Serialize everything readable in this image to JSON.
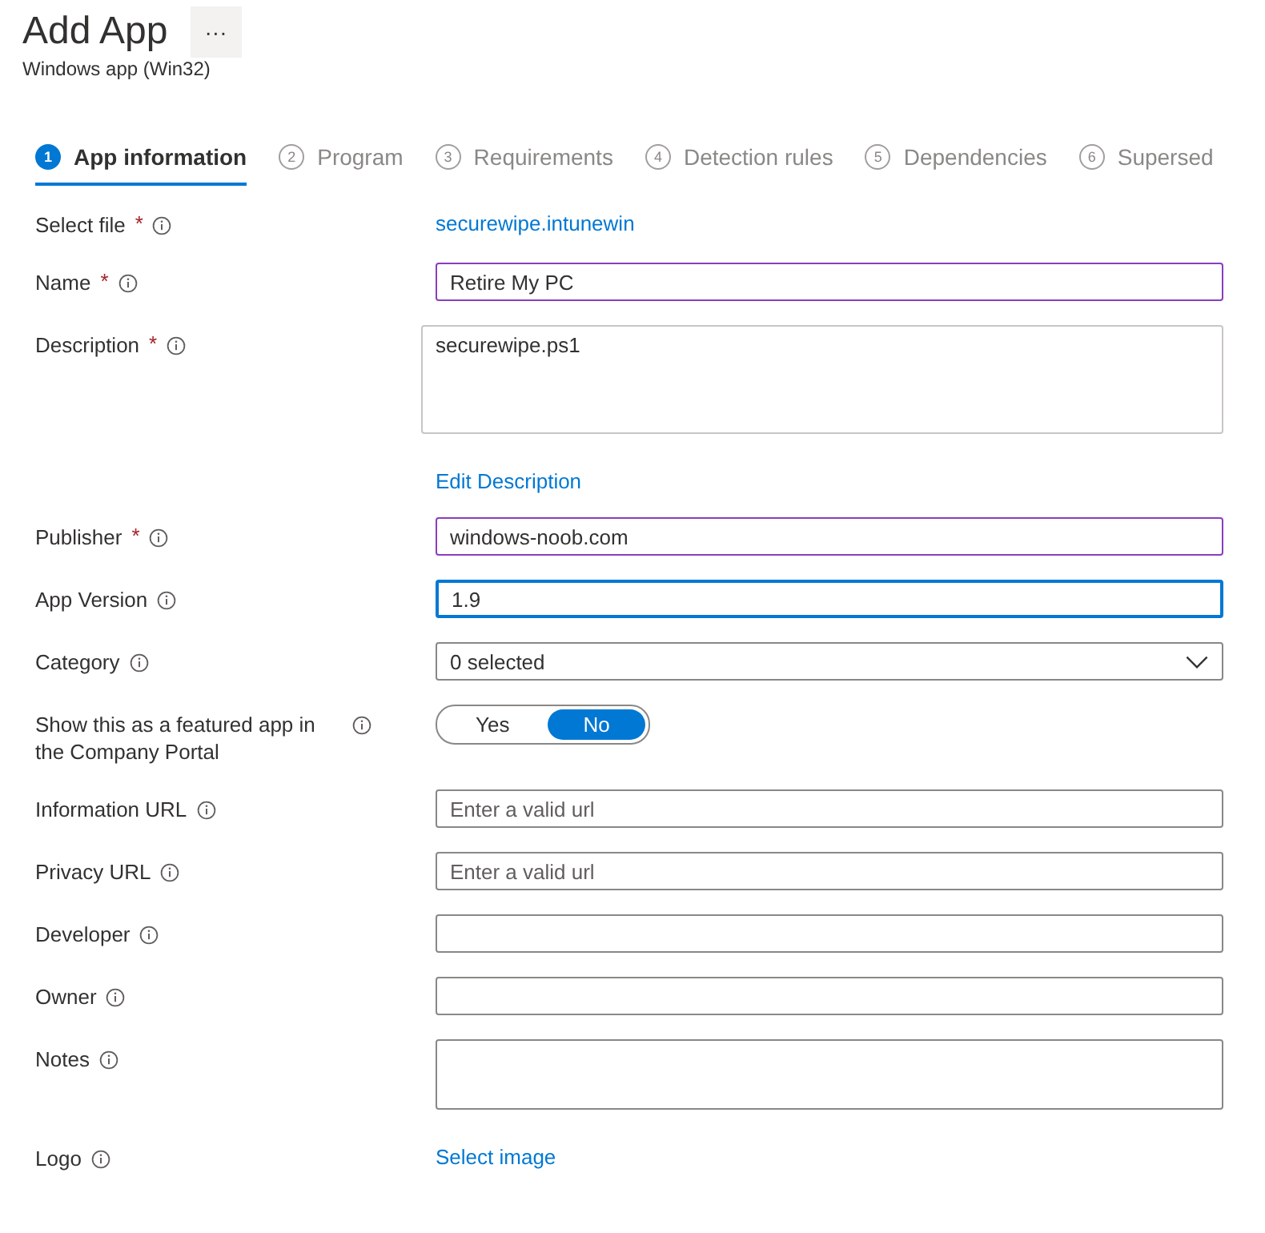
{
  "header": {
    "title": "Add App",
    "more": "···",
    "subtitle": "Windows app (Win32)"
  },
  "steps": [
    {
      "number": "1",
      "label": "App information",
      "selected": true
    },
    {
      "number": "2",
      "label": "Program",
      "selected": false
    },
    {
      "number": "3",
      "label": "Requirements",
      "selected": false
    },
    {
      "number": "4",
      "label": "Detection rules",
      "selected": false
    },
    {
      "number": "5",
      "label": "Dependencies",
      "selected": false
    },
    {
      "number": "6",
      "label": "Supersed",
      "selected": false
    }
  ],
  "fields": [
    {
      "kind": "link",
      "label": "Select file",
      "required_mark": "*",
      "link": "securewipe.intunewin"
    },
    {
      "kind": "input",
      "label": "Name",
      "required_mark": "*",
      "value": "Retire My PC",
      "highlighted": true,
      "focused": false
    },
    {
      "kind": "textarea",
      "label": "Description",
      "required_mark": "*",
      "value": "securewipe.ps1"
    },
    {
      "kind": "link",
      "link": "Edit Description"
    },
    {
      "kind": "input",
      "label": "Publisher",
      "required_mark": "*",
      "value": "windows-noob.com",
      "highlighted": true,
      "focused": false
    },
    {
      "kind": "input",
      "label": "App Version",
      "value": "1.9",
      "highlighted": false,
      "focused": true
    },
    {
      "kind": "dropdown",
      "label": "Category",
      "value": "0 selected"
    },
    {
      "kind": "toggle",
      "label": "Show this as a featured app in the Company Portal",
      "options": [
        {
          "label": "Yes",
          "selected": false
        },
        {
          "label": "No",
          "selected": true
        }
      ]
    },
    {
      "kind": "input",
      "label": "Information URL",
      "placeholder": "Enter a valid url",
      "highlighted": false,
      "focused": false
    },
    {
      "kind": "input",
      "label": "Privacy URL",
      "placeholder": "Enter a valid url",
      "highlighted": false,
      "focused": false
    },
    {
      "kind": "input",
      "label": "Developer",
      "highlighted": false,
      "focused": false
    },
    {
      "kind": "input",
      "label": "Owner",
      "highlighted": false,
      "focused": false
    },
    {
      "kind": "textarea",
      "label": "Notes"
    },
    {
      "kind": "link",
      "label": "Logo",
      "link": "Select image"
    }
  ]
}
